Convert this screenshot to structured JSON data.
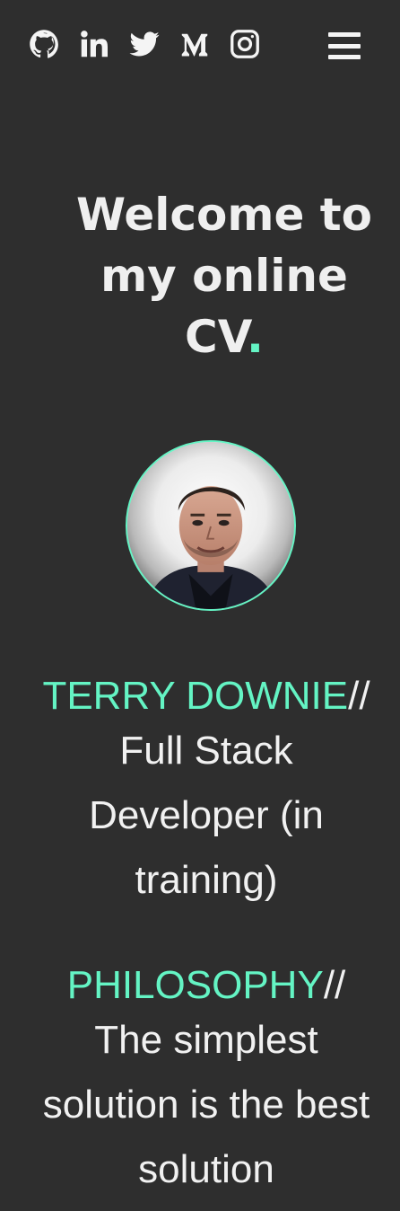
{
  "social_links": [
    {
      "name": "github-icon",
      "label": "GitHub"
    },
    {
      "name": "linkedin-icon",
      "label": "LinkedIn"
    },
    {
      "name": "twitter-icon",
      "label": "Twitter"
    },
    {
      "name": "medium-icon",
      "label": "Medium"
    },
    {
      "name": "instagram-icon",
      "label": "Instagram"
    }
  ],
  "menu": {
    "icon": "hamburger-menu-icon"
  },
  "hero": {
    "title_line1": "Welcome to",
    "title_line2": "my online",
    "title_line3": "CV",
    "title_dot": "."
  },
  "profile": {
    "avatar_alt": "Profile photo",
    "accent_color": "#64f4c4"
  },
  "name_section": {
    "label": "TERRY DOWNIE",
    "separator": "//",
    "role_line1": "Full Stack",
    "role_line2": "Developer (in",
    "role_line3": "training)"
  },
  "philosophy_section": {
    "label": "PHILOSOPHY",
    "separator": "//",
    "line1": "The simplest",
    "line2": "solution is the best",
    "line3": "solution"
  },
  "colors": {
    "background": "#2e2e2e",
    "text": "#f1f1f1",
    "accent": "#64f4c4"
  }
}
